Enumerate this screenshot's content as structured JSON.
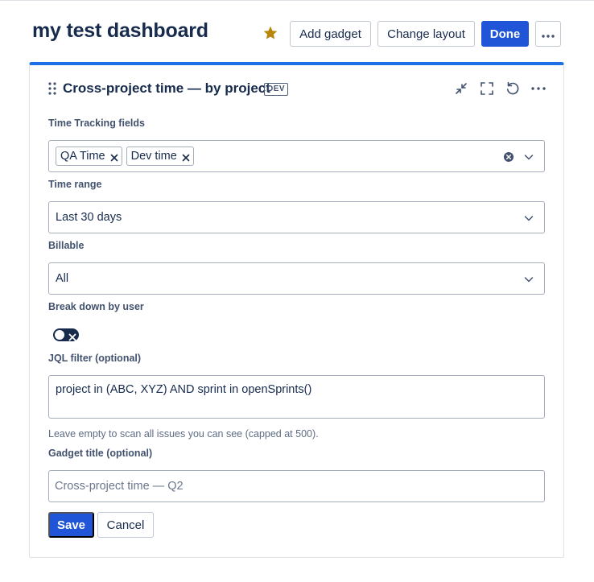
{
  "dashboard": {
    "title": "my test dashboard",
    "star_icon": "star-icon",
    "accent_color": "#1f55d6",
    "star_color": "#b8860b",
    "buttons": {
      "add_gadget": "Add gadget",
      "change_layout": "Change layout",
      "done": "Done",
      "more_icon": "more-horizontal-icon"
    }
  },
  "gadget": {
    "title": "Cross-project time — by project",
    "badge": "DEV",
    "toolbar_icons": [
      "minimize-icon",
      "fullscreen-icon",
      "refresh-icon",
      "more-horizontal-icon"
    ],
    "fields": {
      "time_tracking": {
        "label": "Time Tracking fields",
        "tags": [
          "QA Time",
          "Dev time"
        ]
      },
      "time_range": {
        "label": "Time range",
        "value": "Last 30 days"
      },
      "billable": {
        "label": "Billable",
        "value": "All"
      },
      "breakdown": {
        "label": "Break down by user",
        "enabled": false
      },
      "jql": {
        "label": "JQL filter (optional)",
        "value": "project in (ABC, XYZ) AND sprint in openSprints()",
        "helper": "Leave empty to scan all issues you can see (capped at 500)."
      },
      "gadget_title": {
        "label": "Gadget title (optional)",
        "placeholder": "Cross-project time — Q2"
      }
    },
    "actions": {
      "save": "Save",
      "cancel": "Cancel"
    }
  }
}
